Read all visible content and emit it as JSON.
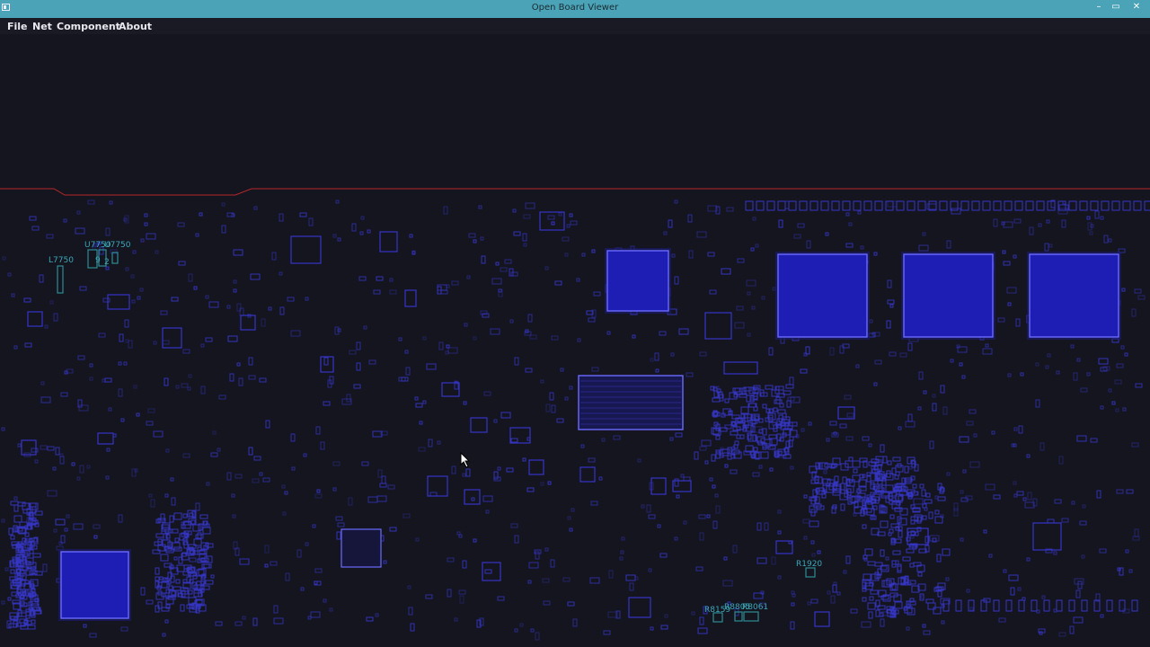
{
  "window": {
    "title": "Open Board Viewer",
    "minimize_glyph": "–",
    "maximize_glyph": "▭",
    "close_glyph": "✕"
  },
  "menu": {
    "items": [
      "File",
      "Net",
      "Component",
      "About"
    ]
  },
  "board": {
    "outline_color": "#b5282a",
    "pad_color": "#3535c8",
    "component_labels": [
      "L7750",
      "U7750",
      "U7750",
      "9",
      "2",
      "R1920",
      "R8159",
      "R8805",
      "R8061"
    ]
  }
}
